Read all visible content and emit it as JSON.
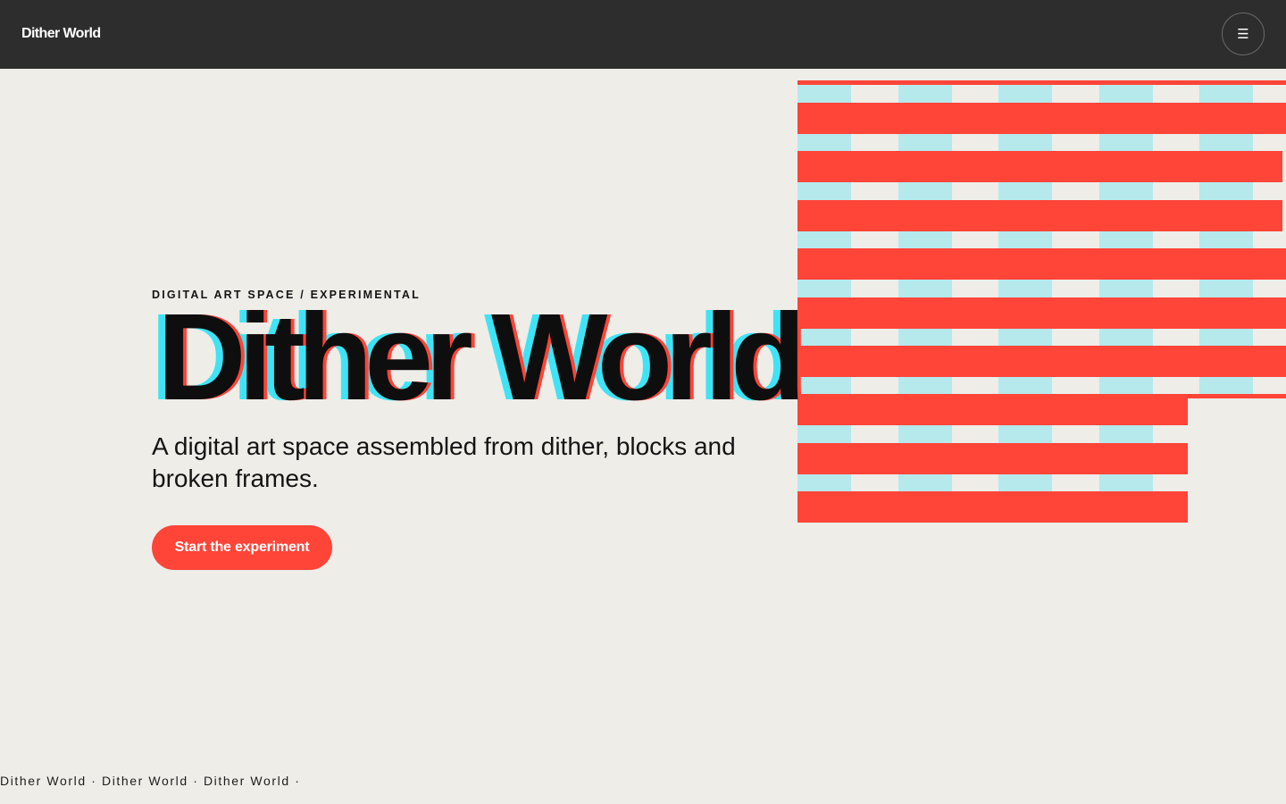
{
  "header": {
    "brand": "Dither World",
    "menu_icon": "☰"
  },
  "hero": {
    "eyebrow": "DIGITAL ART SPACE / EXPERIMENTAL",
    "title": "Dither World",
    "subtitle": "A digital art space assembled from dither, blocks and broken frames.",
    "cta_label": "Start the experiment"
  },
  "footer": {
    "marquee": "Dither World · Dither World · Dither World ·"
  },
  "art": {
    "icon": "dither-stripes-graphic",
    "red_color": "#FF4438",
    "cyan_color": "#B5E9EC"
  },
  "colors": {
    "background": "#EEEDE8",
    "topbar": "#2D2D2D",
    "accent_red": "#FF4438",
    "accent_cyan": "#3FE3F6",
    "text": "#0E0E0E"
  }
}
